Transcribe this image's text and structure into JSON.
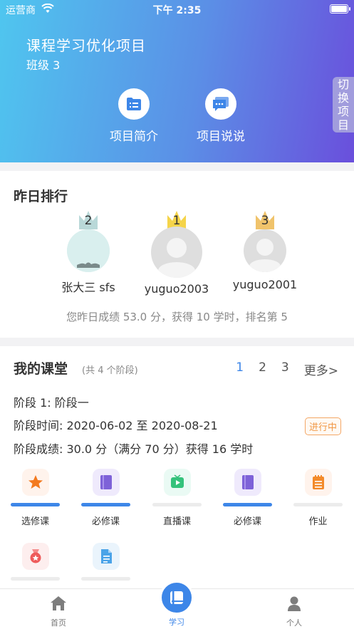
{
  "status_bar": {
    "carrier": "运营商",
    "time": "下午 2:35"
  },
  "header": {
    "title": "课程学习优化项目",
    "class_name": "班级 3",
    "switch_label": "切换项目",
    "switch_chars": [
      "切",
      "换",
      "项",
      "目"
    ],
    "buttons": [
      {
        "label": "项目简介",
        "icon": "list-icon"
      },
      {
        "label": "项目说说",
        "icon": "chat-icon"
      }
    ]
  },
  "ranking": {
    "title": "昨日排行",
    "rankers": [
      {
        "rank": "2",
        "name": "张大三 sfs",
        "crown_color": "#b9d8d8"
      },
      {
        "rank": "1",
        "name": "yuguo2003",
        "crown_color": "#f5d44a"
      },
      {
        "rank": "3",
        "name": "yuguo2001",
        "crown_color": "#f0c36b"
      }
    ],
    "summary": "您昨日成绩 53.0 分，获得 10 学时，排名第 5"
  },
  "classroom": {
    "title": "我的课堂",
    "stage_count": "(共 4 个阶段)",
    "pages": [
      "1",
      "2",
      "3"
    ],
    "active_page": "1",
    "more": "更多>",
    "stage_name": "阶段 1:  阶段一",
    "stage_time": "阶段时间:  2020-06-02 至 2020-08-21",
    "stage_score": "阶段成绩:  30.0 分（满分 70 分）获得 16 学时",
    "status_badge": "进行中",
    "modules": [
      {
        "label": "选修课",
        "icon": "star-icon",
        "bg": "#fff3ec",
        "active": true
      },
      {
        "label": "必修课",
        "icon": "book-icon",
        "bg": "#efeafc",
        "active": true
      },
      {
        "label": "直播课",
        "icon": "play-icon",
        "bg": "#eafaf4",
        "active": false
      },
      {
        "label": "必修课",
        "icon": "book-icon",
        "bg": "#efeafc",
        "active": true
      },
      {
        "label": "作业",
        "icon": "notepad-icon",
        "bg": "#fff3ec",
        "active": false
      },
      {
        "label": "",
        "icon": "medal-icon",
        "bg": "#fdeeee",
        "active": false
      },
      {
        "label": "",
        "icon": "document-icon",
        "bg": "#eaf4fc",
        "active": false
      }
    ]
  },
  "tabbar": {
    "home": "首页",
    "learn": "学习",
    "me": "个人"
  },
  "colors": {
    "accent": "#3d86e8",
    "badge": "#f19744"
  }
}
